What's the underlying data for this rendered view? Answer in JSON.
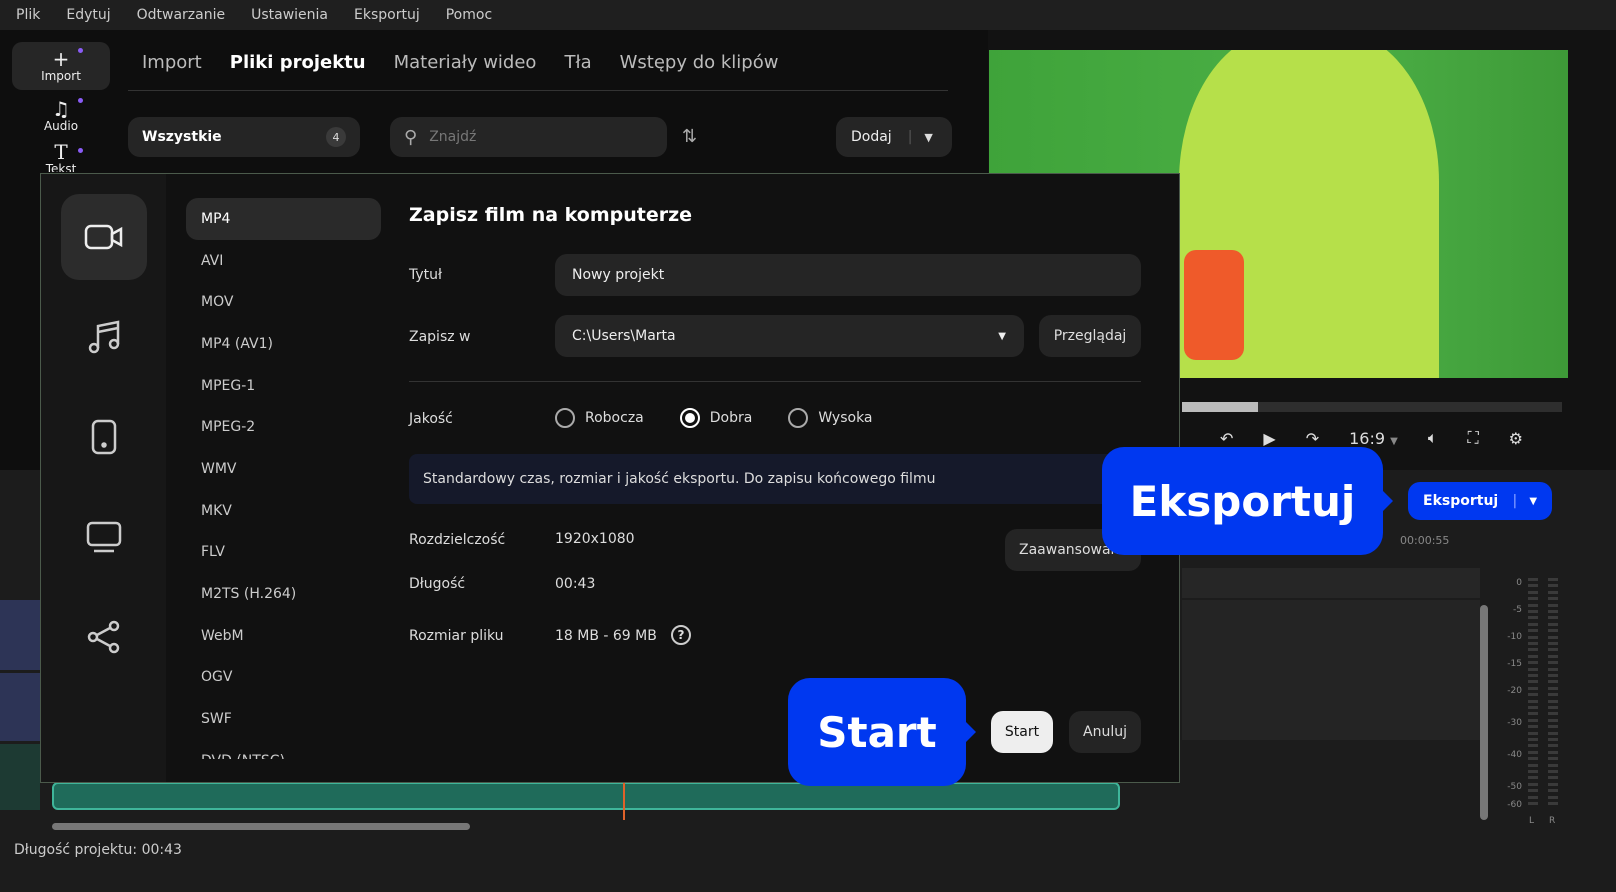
{
  "menu": [
    "Plik",
    "Edytuj",
    "Odtwarzanie",
    "Ustawienia",
    "Eksportuj",
    "Pomoc"
  ],
  "rail": {
    "import": "Import",
    "audio": "Audio",
    "text": "Tekst"
  },
  "library": {
    "tabs": [
      "Import",
      "Pliki projektu",
      "Materiały wideo",
      "Tła",
      "Wstępy do klipów"
    ],
    "active_tab": "Pliki projektu",
    "filter_label": "Wszystkie",
    "filter_count": "4",
    "search_placeholder": "Znajdź",
    "add_label": "Dodaj"
  },
  "player": {
    "aspect": "16:9",
    "progress": 0.2,
    "export_label": "Eksportuj",
    "time_marker": "00:00:55"
  },
  "dialog": {
    "formats": [
      "MP4",
      "AVI",
      "MOV",
      "MP4 (AV1)",
      "MPEG-1",
      "MPEG-2",
      "WMV",
      "MKV",
      "FLV",
      "M2TS (H.264)",
      "WebM",
      "OGV",
      "SWF",
      "DVD (NTSC)"
    ],
    "selected_format": "MP4",
    "title": "Zapisz film na komputerze",
    "title_label": "Tytuł",
    "title_value": "Nowy projekt",
    "save_label": "Zapisz w",
    "save_value": "C:\\Users\\Marta",
    "browse": "Przeglądaj",
    "quality_label": "Jakość",
    "quality_options": [
      "Robocza",
      "Dobra",
      "Wysoka"
    ],
    "quality_selected": "Dobra",
    "quality_desc": "Standardowy czas, rozmiar i jakość eksportu. Do zapisu końcowego filmu",
    "resolution_label": "Rozdzielczość",
    "resolution": "1920x1080",
    "advanced": "Zaawansowane",
    "duration_label": "Długość",
    "duration": "00:43",
    "size_label": "Rozmiar pliku",
    "size": "18 MB - 69 MB",
    "start": "Start",
    "cancel": "Anuluj"
  },
  "callouts": {
    "export": "Eksportuj",
    "start": "Start"
  },
  "meter": {
    "ticks": [
      "0",
      "-5",
      "-10",
      "-15",
      "-20",
      "-30",
      "-40",
      "-50",
      "-60"
    ],
    "channels": [
      "L",
      "R"
    ]
  },
  "status": {
    "project_length": "Długość projektu: 00:43"
  },
  "colors": {
    "accent": "#0038f0",
    "audio_track": "#3fb59a",
    "video_track": "#2d3456"
  }
}
